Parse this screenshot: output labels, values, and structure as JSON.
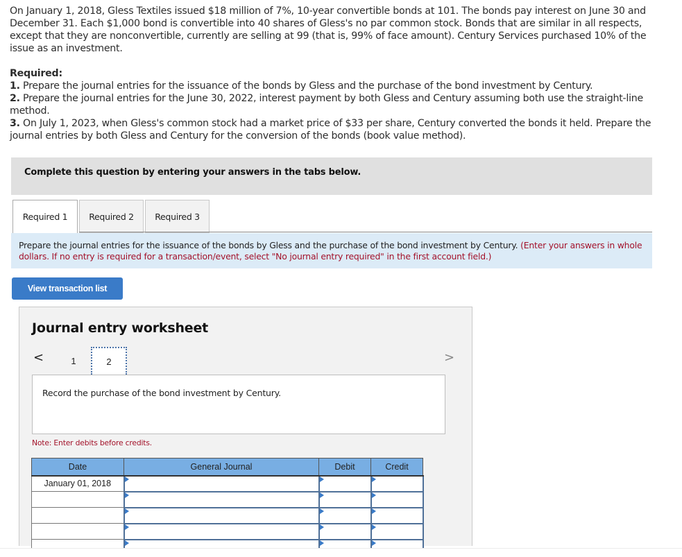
{
  "problem": {
    "text": "On January 1, 2018, Gless Textiles issued $18 million of 7%, 10-year convertible bonds at 101. The bonds pay interest on June 30 and December 31. Each $1,000 bond is convertible into 40 shares of Gless's no par common stock. Bonds that are similar in all respects, except that they are nonconvertible, currently are selling at 99 (that is, 99% of face amount). Century Services purchased 10% of the issue as an investment."
  },
  "required": {
    "title": "Required:",
    "items": [
      {
        "num": "1.",
        "text": " Prepare the journal entries for the issuance of the bonds by Gless and the purchase of the bond investment by Century."
      },
      {
        "num": "2.",
        "text": " Prepare the journal entries for the June 30, 2022, interest payment by both Gless and Century assuming both use the straight-line method."
      },
      {
        "num": "3.",
        "text": " On July 1, 2023, when Gless's common stock had a market price of $33 per share, Century converted the bonds it held. Prepare the journal entries by both Gless and Century for the conversion of the bonds (book value method)."
      }
    ]
  },
  "instruction_bar": "Complete this question by entering your answers in the tabs below.",
  "tabs": [
    {
      "label": "Required 1",
      "active": true
    },
    {
      "label": "Required 2",
      "active": false
    },
    {
      "label": "Required 3",
      "active": false
    }
  ],
  "prompt": {
    "main": "Prepare the journal entries for the issuance of the bonds by Gless and the purchase of the bond investment by Century. ",
    "note": "(Enter your answers in whole dollars. If no entry is required for a transaction/event, select \"No journal entry required\" in the first account field.)"
  },
  "view_transaction_button": "View transaction list",
  "worksheet": {
    "title": "Journal entry worksheet",
    "prev_icon": "<",
    "next_icon": ">",
    "pages": [
      "1",
      "2"
    ],
    "current_page": "2",
    "description": "Record the purchase of the bond investment by Century.",
    "note": "Note: Enter debits before credits.",
    "table": {
      "headers": [
        "Date",
        "General Journal",
        "Debit",
        "Credit"
      ],
      "rows": [
        {
          "date": "January 01, 2018",
          "account": "",
          "debit": "",
          "credit": ""
        },
        {
          "date": "",
          "account": "",
          "debit": "",
          "credit": ""
        },
        {
          "date": "",
          "account": "",
          "debit": "",
          "credit": ""
        },
        {
          "date": "",
          "account": "",
          "debit": "",
          "credit": ""
        },
        {
          "date": "",
          "account": "",
          "debit": "",
          "credit": ""
        }
      ]
    }
  }
}
